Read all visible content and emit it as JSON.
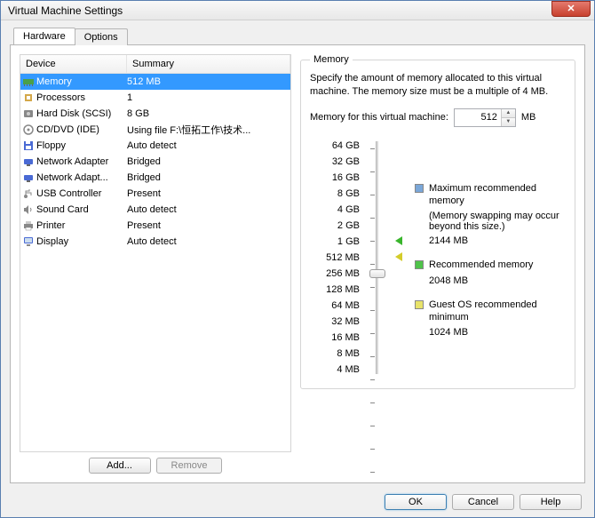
{
  "window": {
    "title": "Virtual Machine Settings"
  },
  "tabs": {
    "hardware": "Hardware",
    "options": "Options"
  },
  "devlist": {
    "headers": {
      "device": "Device",
      "summary": "Summary"
    },
    "items": [
      {
        "name": "Memory",
        "summary": "512 MB",
        "icon": "memory"
      },
      {
        "name": "Processors",
        "summary": "1",
        "icon": "cpu"
      },
      {
        "name": "Hard Disk (SCSI)",
        "summary": "8 GB",
        "icon": "hdd"
      },
      {
        "name": "CD/DVD (IDE)",
        "summary": "Using file F:\\恒拓工作\\技术...",
        "icon": "cd"
      },
      {
        "name": "Floppy",
        "summary": "Auto detect",
        "icon": "floppy"
      },
      {
        "name": "Network Adapter",
        "summary": "Bridged",
        "icon": "net"
      },
      {
        "name": "Network Adapt...",
        "summary": "Bridged",
        "icon": "net"
      },
      {
        "name": "USB Controller",
        "summary": "Present",
        "icon": "usb"
      },
      {
        "name": "Sound Card",
        "summary": "Auto detect",
        "icon": "sound"
      },
      {
        "name": "Printer",
        "summary": "Present",
        "icon": "printer"
      },
      {
        "name": "Display",
        "summary": "Auto detect",
        "icon": "display"
      }
    ],
    "selected_index": 0
  },
  "buttons": {
    "add": "Add...",
    "remove": "Remove",
    "ok": "OK",
    "cancel": "Cancel",
    "help": "Help"
  },
  "memory": {
    "title": "Memory",
    "desc": "Specify the amount of memory allocated to this virtual machine. The memory size must be a multiple of 4 MB.",
    "label": "Memory for this virtual machine:",
    "value": "512",
    "unit": "MB",
    "ticks": [
      "64 GB",
      "32 GB",
      "16 GB",
      "8 GB",
      "4 GB",
      "2 GB",
      "1 GB",
      "512 MB",
      "256 MB",
      "128 MB",
      "64 MB",
      "32 MB",
      "16 MB",
      "8 MB",
      "4 MB"
    ],
    "legend": {
      "max": {
        "label": "Maximum recommended memory",
        "sub": "(Memory swapping may occur beyond this size.)",
        "value": "2144 MB"
      },
      "rec": {
        "label": "Recommended memory",
        "value": "2048 MB"
      },
      "min": {
        "label": "Guest OS recommended minimum",
        "value": "1024 MB"
      }
    }
  }
}
